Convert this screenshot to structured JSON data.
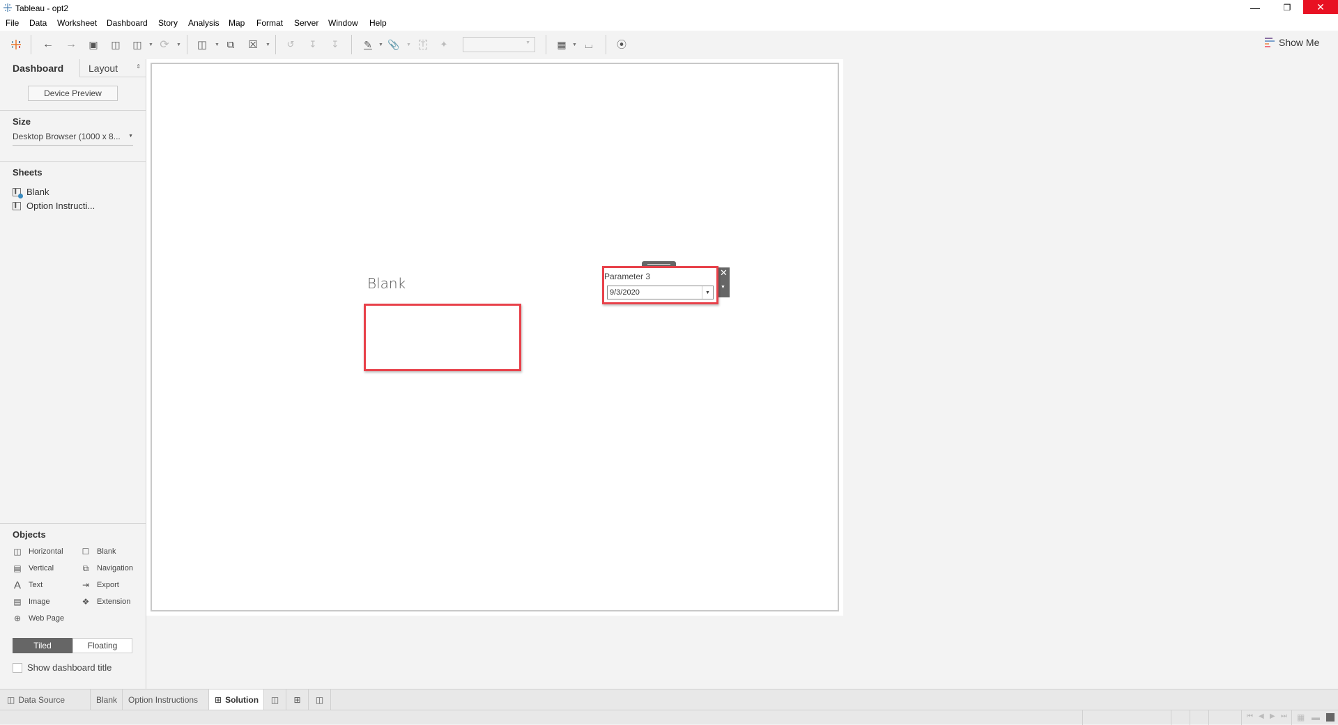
{
  "window": {
    "title": "Tableau - opt2",
    "minimize_icon": "minimize-icon",
    "restore_icon": "restore-icon",
    "close_icon": "close-icon",
    "close_color": "#e81123"
  },
  "menu": [
    "File",
    "Data",
    "Worksheet",
    "Dashboard",
    "Story",
    "Analysis",
    "Map",
    "Format",
    "Server",
    "Window",
    "Help"
  ],
  "toolbar": {
    "show_me_label": "Show Me",
    "fit_dropdown_value": ""
  },
  "left_panel": {
    "tabs": [
      {
        "label": "Dashboard",
        "active": true
      },
      {
        "label": "Layout",
        "active": false
      }
    ],
    "device_preview_label": "Device Preview",
    "size": {
      "title": "Size",
      "value": "Desktop Browser (1000 x 8..."
    },
    "sheets": {
      "title": "Sheets",
      "items": [
        {
          "label": "Blank",
          "icon": "sheet-used-icon"
        },
        {
          "label": "Option Instructi...",
          "icon": "sheet-icon"
        }
      ]
    },
    "objects": {
      "title": "Objects",
      "items": [
        {
          "label": "Horizontal",
          "icon": "horizontal-container-icon"
        },
        {
          "label": "Blank",
          "icon": "blank-icon"
        },
        {
          "label": "Vertical",
          "icon": "vertical-container-icon"
        },
        {
          "label": "Navigation",
          "icon": "navigation-icon"
        },
        {
          "label": "Text",
          "icon": "text-icon"
        },
        {
          "label": "Export",
          "icon": "export-icon"
        },
        {
          "label": "Image",
          "icon": "image-icon"
        },
        {
          "label": "Extension",
          "icon": "extension-icon"
        },
        {
          "label": "Web Page",
          "icon": "web-page-icon"
        }
      ]
    },
    "layout_mode": {
      "tiled_label": "Tiled",
      "floating_label": "Floating",
      "selected": "Tiled"
    },
    "show_title_label": "Show dashboard title",
    "show_title_checked": false
  },
  "dashboard": {
    "blank_sheet_title": "Blank",
    "parameter": {
      "label": "Parameter 3",
      "value": "9/3/2020"
    },
    "highlight_color": "#e8414a"
  },
  "bottom_tabs": [
    {
      "label": "Data Source",
      "icon": "database-icon"
    },
    {
      "label": "Blank"
    },
    {
      "label": "Option Instructions"
    },
    {
      "label": "Solution",
      "icon": "dashboard-icon",
      "active": true
    }
  ]
}
